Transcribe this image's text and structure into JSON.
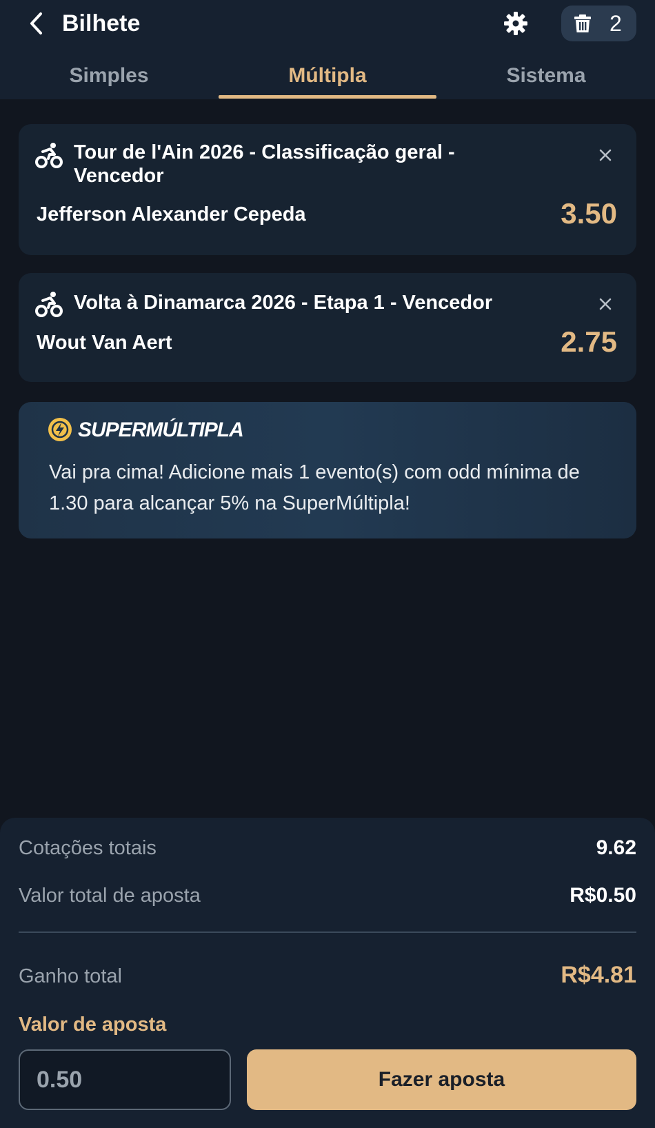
{
  "header": {
    "title": "Bilhete",
    "selection_count": "2"
  },
  "tabs": [
    {
      "label": "Simples"
    },
    {
      "label": "Múltipla"
    },
    {
      "label": "Sistema"
    }
  ],
  "bets": [
    {
      "event": "Tour de l'Ain 2026 - Classificação geral - Vencedor",
      "selection": "Jefferson Alexander Cepeda",
      "odd": "3.50"
    },
    {
      "event": "Volta à Dinamarca 2026 - Etapa 1 - Vencedor",
      "selection": "Wout Van Aert",
      "odd": "2.75"
    }
  ],
  "promo": {
    "brand": "SUPERMÚLTIPLA",
    "message": "Vai pra cima! Adicione mais 1 evento(s) com odd mínima de 1.30 para alcançar 5% na SuperMúltipla!"
  },
  "summary": {
    "total_odds_label": "Cotações totais",
    "total_odds_value": "9.62",
    "total_stake_label": "Valor total de aposta",
    "total_stake_value": "R$0.50",
    "total_gain_label": "Ganho total",
    "total_gain_value": "R$4.81",
    "stake_label": "Valor de aposta",
    "stake_value": "0.50",
    "bet_button": "Fazer aposta"
  },
  "colors": {
    "accent": "#e2b984",
    "background": "#11161f",
    "panel": "#162130",
    "card": "#172331"
  },
  "icons": [
    "back-arrow-icon",
    "gear-icon",
    "trash-icon",
    "cycling-icon",
    "close-icon",
    "lightning-bolt-icon"
  ]
}
